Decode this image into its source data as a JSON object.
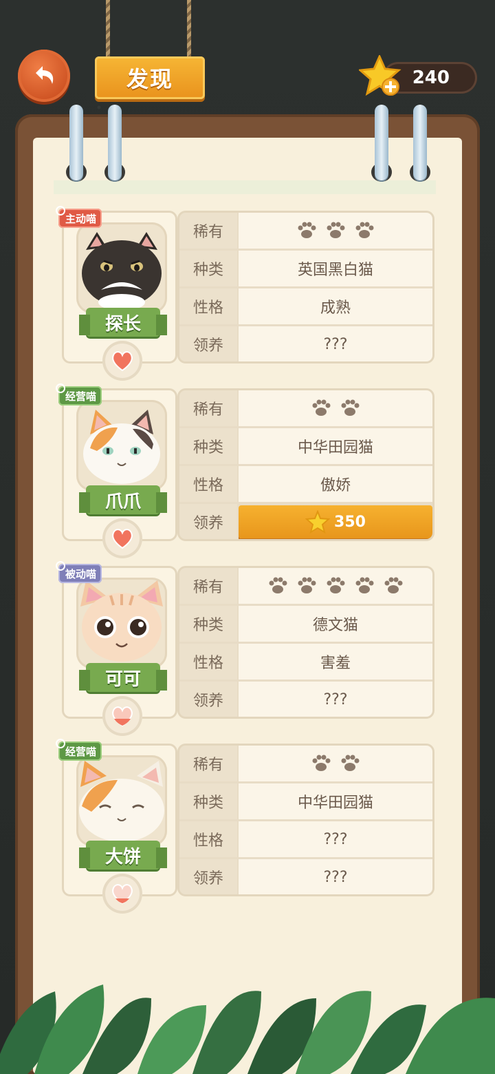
{
  "header": {
    "title": "发现",
    "coins": "240"
  },
  "labels": {
    "rarity": "稀有",
    "breed": "种类",
    "personality": "性格",
    "adopt": "领养"
  },
  "cats": [
    {
      "tag": "主动喵",
      "tag_color": "#e05a45",
      "name": "探长",
      "rarity_paws": 3,
      "breed": "英国黑白猫",
      "personality": "成熟",
      "adopt": "???"
    },
    {
      "tag": "经营喵",
      "tag_color": "#5d9845",
      "name": "爪爪",
      "rarity_paws": 2,
      "breed": "中华田园猫",
      "personality": "傲娇",
      "adopt_price": "350"
    },
    {
      "tag": "被动喵",
      "tag_color": "#7f7fb8",
      "name": "可可",
      "rarity_paws": 5,
      "breed": "德文猫",
      "personality": "害羞",
      "adopt": "???"
    },
    {
      "tag": "经营喵",
      "tag_color": "#5d9845",
      "name": "大饼",
      "rarity_paws": 2,
      "breed": "中华田园猫",
      "personality": "???",
      "adopt": "???"
    }
  ],
  "icons": {
    "back": "back-arrow-icon",
    "coin": "star-icon",
    "heart": "heart-icon",
    "paw": "paw-icon"
  }
}
